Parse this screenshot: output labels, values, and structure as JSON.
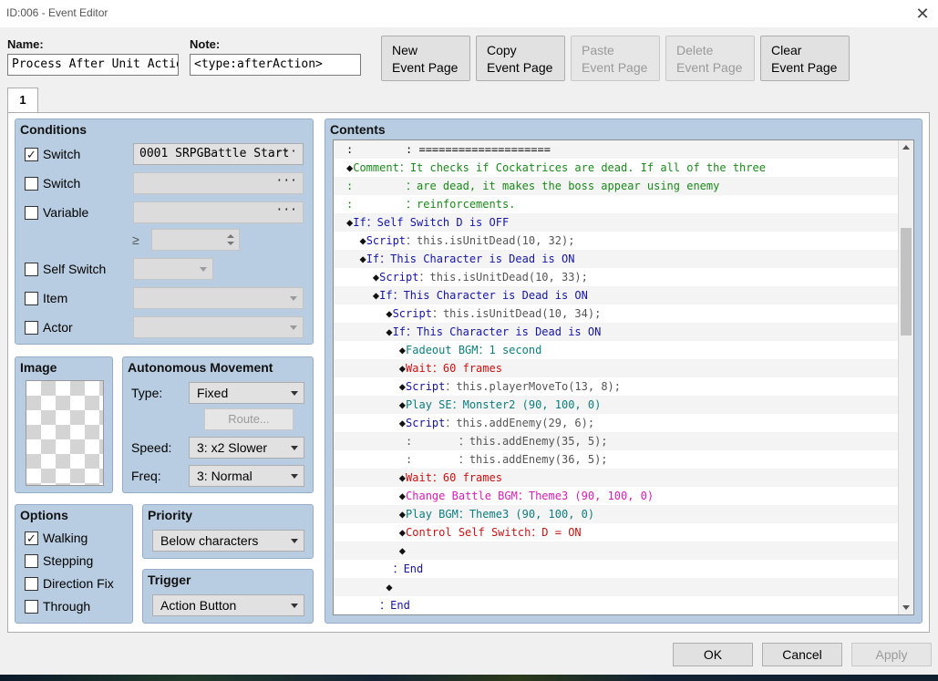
{
  "window": {
    "title": "ID:006 - Event Editor",
    "close_icon": "close-icon"
  },
  "header": {
    "name_label": "Name:",
    "name_value": "Process After Unit Action",
    "note_label": "Note:",
    "note_value": "<type:afterAction>"
  },
  "page_buttons": [
    {
      "line1": "New",
      "line2": "Event Page",
      "enabled": true
    },
    {
      "line1": "Copy",
      "line2": "Event Page",
      "enabled": true
    },
    {
      "line1": "Paste",
      "line2": "Event Page",
      "enabled": false
    },
    {
      "line1": "Delete",
      "line2": "Event Page",
      "enabled": false
    },
    {
      "line1": "Clear",
      "line2": "Event Page",
      "enabled": true
    }
  ],
  "tabs": [
    {
      "label": "1"
    }
  ],
  "conditions": {
    "title": "Conditions",
    "switch1": {
      "label": "Switch",
      "checked": true,
      "check_mark": "✓",
      "value": "0001 SRPGBattle Start",
      "dots": "···"
    },
    "switch2": {
      "label": "Switch",
      "checked": false,
      "value": "",
      "dots": "···"
    },
    "variable": {
      "label": "Variable",
      "checked": false,
      "value": "",
      "dots": "···",
      "ge_symbol": "≥"
    },
    "self_switch": {
      "label": "Self Switch",
      "checked": false
    },
    "item": {
      "label": "Item",
      "checked": false
    },
    "actor": {
      "label": "Actor",
      "checked": false
    }
  },
  "image": {
    "title": "Image"
  },
  "autonomous": {
    "title": "Autonomous Movement",
    "type_label": "Type:",
    "type_value": "Fixed",
    "route_label": "Route...",
    "speed_label": "Speed:",
    "speed_value": "3: x2 Slower",
    "freq_label": "Freq:",
    "freq_value": "3: Normal"
  },
  "options": {
    "title": "Options",
    "check_mark": "✓",
    "items": [
      {
        "label": "Walking",
        "checked": true
      },
      {
        "label": "Stepping",
        "checked": false
      },
      {
        "label": "Direction Fix",
        "checked": false
      },
      {
        "label": "Through",
        "checked": false
      }
    ]
  },
  "priority": {
    "title": "Priority",
    "value": "Below characters"
  },
  "trigger": {
    "title": "Trigger",
    "value": "Action Button"
  },
  "contents": {
    "title": "Contents",
    "lines": [
      [
        {
          "t": ":        : ====================",
          "c": "black"
        }
      ],
      [
        {
          "t": "◆",
          "c": "black"
        },
        {
          "t": "Comment",
          "c": "green"
        },
        {
          "t": "：It checks if Cockatrices are dead. If all of the three",
          "c": "green"
        }
      ],
      [
        {
          "t": ":        ：are dead, it makes the boss appear using enemy",
          "c": "green"
        }
      ],
      [
        {
          "t": ":        ：reinforcements.",
          "c": "green"
        }
      ],
      [
        {
          "t": "◆",
          "c": "black"
        },
        {
          "t": "If：Self Switch D is OFF",
          "c": "blue"
        }
      ],
      [
        {
          "t": "  ◆",
          "c": "black"
        },
        {
          "t": "Script",
          "c": "blue"
        },
        {
          "t": "：this.isUnitDead(10, 32);",
          "c": "gray"
        }
      ],
      [
        {
          "t": "  ◆",
          "c": "black"
        },
        {
          "t": "If：This Character is Dead is ON",
          "c": "blue"
        }
      ],
      [
        {
          "t": "    ◆",
          "c": "black"
        },
        {
          "t": "Script",
          "c": "blue"
        },
        {
          "t": "：this.isUnitDead(10, 33);",
          "c": "gray"
        }
      ],
      [
        {
          "t": "    ◆",
          "c": "black"
        },
        {
          "t": "If：This Character is Dead is ON",
          "c": "blue"
        }
      ],
      [
        {
          "t": "      ◆",
          "c": "black"
        },
        {
          "t": "Script",
          "c": "blue"
        },
        {
          "t": "：this.isUnitDead(10, 34);",
          "c": "gray"
        }
      ],
      [
        {
          "t": "      ◆",
          "c": "black"
        },
        {
          "t": "If：This Character is Dead is ON",
          "c": "blue"
        }
      ],
      [
        {
          "t": "        ◆",
          "c": "black"
        },
        {
          "t": "Fadeout BGM：1 second",
          "c": "teal"
        }
      ],
      [
        {
          "t": "        ◆",
          "c": "black"
        },
        {
          "t": "Wait：60 frames",
          "c": "red"
        }
      ],
      [
        {
          "t": "        ◆",
          "c": "black"
        },
        {
          "t": "Script",
          "c": "blue"
        },
        {
          "t": "：this.playerMoveTo(13, 8);",
          "c": "gray"
        }
      ],
      [
        {
          "t": "        ◆",
          "c": "black"
        },
        {
          "t": "Play SE：Monster2 (90, 100, 0)",
          "c": "teal"
        }
      ],
      [
        {
          "t": "        ◆",
          "c": "black"
        },
        {
          "t": "Script",
          "c": "blue"
        },
        {
          "t": "：this.addEnemy(29, 6);",
          "c": "gray"
        }
      ],
      [
        {
          "t": "         :       ：this.addEnemy(35, 5);",
          "c": "gray"
        }
      ],
      [
        {
          "t": "         :       ：this.addEnemy(36, 5);",
          "c": "gray"
        }
      ],
      [
        {
          "t": "        ◆",
          "c": "black"
        },
        {
          "t": "Wait：60 frames",
          "c": "red"
        }
      ],
      [
        {
          "t": "        ◆",
          "c": "black"
        },
        {
          "t": "Change Battle BGM：Theme3 (90, 100, 0)",
          "c": "pink"
        }
      ],
      [
        {
          "t": "        ◆",
          "c": "black"
        },
        {
          "t": "Play BGM：Theme3 (90, 100, 0)",
          "c": "teal"
        }
      ],
      [
        {
          "t": "        ◆",
          "c": "black"
        },
        {
          "t": "Control Self Switch：D = ON",
          "c": "red"
        }
      ],
      [
        {
          "t": "        ◆",
          "c": "black"
        }
      ],
      [
        {
          "t": "       ",
          "c": "black"
        },
        {
          "t": "：End",
          "c": "blue"
        }
      ],
      [
        {
          "t": "      ◆",
          "c": "black"
        }
      ],
      [
        {
          "t": "     ",
          "c": "black"
        },
        {
          "t": "：End",
          "c": "blue"
        }
      ]
    ]
  },
  "dialog_buttons": {
    "ok": "OK",
    "cancel": "Cancel",
    "apply": "Apply"
  }
}
